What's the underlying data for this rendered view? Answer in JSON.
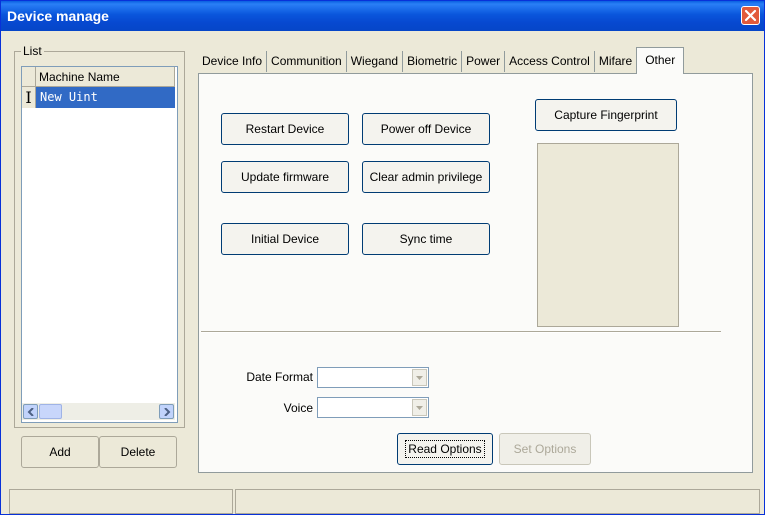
{
  "window": {
    "title": "Device manage"
  },
  "list": {
    "group_label": "List",
    "column_header": "Machine Name",
    "rows": [
      {
        "indicator": "I",
        "name": "New Uint"
      }
    ],
    "add_label": "Add",
    "delete_label": "Delete"
  },
  "tabs": [
    {
      "label": "Device Info"
    },
    {
      "label": "Communition"
    },
    {
      "label": "Wiegand"
    },
    {
      "label": "Biometric"
    },
    {
      "label": "Power"
    },
    {
      "label": "Access Control"
    },
    {
      "label": "Mifare"
    },
    {
      "label": "Other"
    }
  ],
  "active_tab": "Other",
  "other": {
    "restart_label": "Restart Device",
    "power_off_label": "Power off Device",
    "update_firmware_label": "Update firmware",
    "clear_admin_label": "Clear admin privilege",
    "initial_device_label": "Initial Device",
    "sync_time_label": "Sync time",
    "capture_fingerprint_label": "Capture Fingerprint",
    "date_format_label": "Date Format",
    "date_format_value": "",
    "voice_label": "Voice",
    "voice_value": "",
    "read_options_label": "Read Options",
    "set_options_label": "Set Options"
  },
  "colors": {
    "titlebar": "#0a56dc",
    "selection": "#316ac5",
    "face": "#ece9d8",
    "close": "#e25a3b"
  }
}
